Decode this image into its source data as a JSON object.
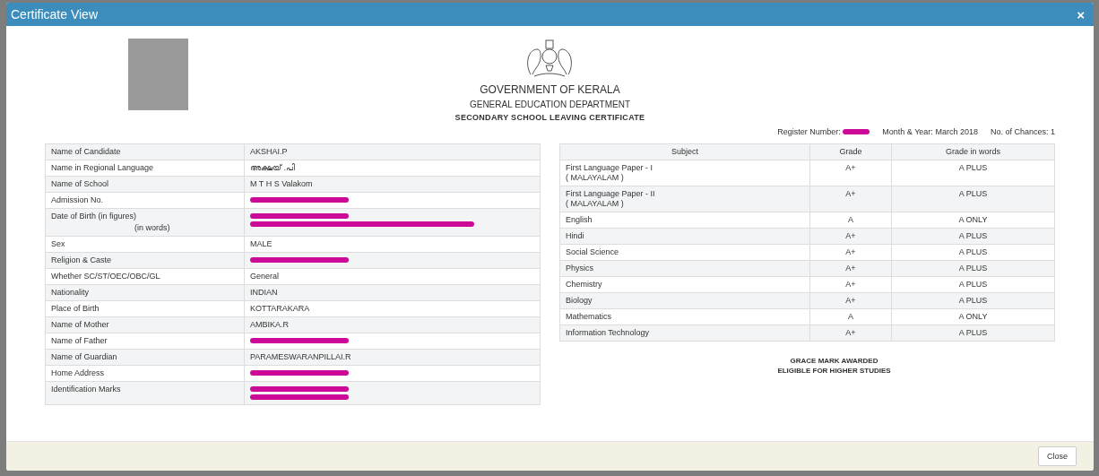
{
  "window": {
    "title": "Certificate View",
    "close_glyph": "×"
  },
  "header": {
    "lines": [
      {
        "kind": "title",
        "text": "GOVERNMENT OF KERALA"
      },
      {
        "kind": "subtitle",
        "text": "GENERAL EDUCATION DEPARTMENT"
      },
      {
        "kind": "heading",
        "text": "SECONDARY SCHOOL LEAVING CERTIFICATE"
      }
    ]
  },
  "meta": [
    {
      "label": "Register Number:",
      "redacted": true
    },
    {
      "label": "Month & Year:",
      "value": "March 2018",
      "redacted": false
    },
    {
      "label": "No. of Chances:",
      "value": "1",
      "redacted": false
    }
  ],
  "candidate_details": [
    {
      "labels": [
        "Name of Candidate"
      ],
      "values": [
        {
          "text": "AKSHAI.P",
          "redacted": false
        }
      ]
    },
    {
      "labels": [
        "Name in Regional Language"
      ],
      "values": [
        {
          "text": "അക്ഷയ് .പി",
          "redacted": false
        }
      ]
    },
    {
      "labels": [
        "Name of School"
      ],
      "values": [
        {
          "text": "M T H S Valakom",
          "redacted": false
        }
      ]
    },
    {
      "labels": [
        "Admission No."
      ],
      "values": [
        {
          "redacted": true
        }
      ]
    },
    {
      "labels": [
        "Date of Birth (in figures)",
        "(in words)"
      ],
      "values": [
        {
          "redacted": true
        },
        {
          "redacted": true
        }
      ]
    },
    {
      "labels": [
        "Sex"
      ],
      "values": [
        {
          "text": "MALE",
          "redacted": false
        }
      ]
    },
    {
      "labels": [
        "Religion & Caste"
      ],
      "values": [
        {
          "redacted": true
        }
      ]
    },
    {
      "labels": [
        "Whether SC/ST/OEC/OBC/GL"
      ],
      "values": [
        {
          "text": "General",
          "redacted": false
        }
      ]
    },
    {
      "labels": [
        "Nationality"
      ],
      "values": [
        {
          "text": "INDIAN",
          "redacted": false
        }
      ]
    },
    {
      "labels": [
        "Place of Birth"
      ],
      "values": [
        {
          "text": "KOTTARAKARA",
          "redacted": false
        }
      ]
    },
    {
      "labels": [
        "Name of Mother"
      ],
      "values": [
        {
          "text": "AMBIKA.R",
          "redacted": false
        }
      ]
    },
    {
      "labels": [
        "Name of Father"
      ],
      "values": [
        {
          "redacted": true
        }
      ]
    },
    {
      "labels": [
        "Name of Guardian"
      ],
      "values": [
        {
          "text": "PARAMESWARANPILLAI.R",
          "redacted": false
        }
      ]
    },
    {
      "labels": [
        "Home Address"
      ],
      "values": [
        {
          "redacted": true
        }
      ]
    },
    {
      "labels": [
        "Identification Marks"
      ],
      "values": [
        {
          "redacted": true
        },
        {
          "redacted": true
        }
      ]
    }
  ],
  "grades": {
    "columns": [
      "Subject",
      "Grade",
      "Grade in words"
    ],
    "rows": [
      {
        "subject": [
          "First Language Paper - I",
          "( MALAYALAM )"
        ],
        "grade": "A+",
        "grade_words": "A PLUS"
      },
      {
        "subject": [
          "First Language Paper - II",
          "( MALAYALAM )"
        ],
        "grade": "A+",
        "grade_words": "A PLUS"
      },
      {
        "subject": [
          "English"
        ],
        "grade": "A",
        "grade_words": "A ONLY"
      },
      {
        "subject": [
          "Hindi"
        ],
        "grade": "A+",
        "grade_words": "A PLUS"
      },
      {
        "subject": [
          "Social Science"
        ],
        "grade": "A+",
        "grade_words": "A PLUS"
      },
      {
        "subject": [
          "Physics"
        ],
        "grade": "A+",
        "grade_words": "A PLUS"
      },
      {
        "subject": [
          "Chemistry"
        ],
        "grade": "A+",
        "grade_words": "A PLUS"
      },
      {
        "subject": [
          "Biology"
        ],
        "grade": "A+",
        "grade_words": "A PLUS"
      },
      {
        "subject": [
          "Mathematics"
        ],
        "grade": "A",
        "grade_words": "A ONLY"
      },
      {
        "subject": [
          "Information Technology"
        ],
        "grade": "A+",
        "grade_words": "A PLUS"
      }
    ]
  },
  "remarks": [
    "GRACE MARK AWARDED",
    "ELIGIBLE FOR HIGHER STUDIES"
  ],
  "footer": {
    "buttons": [
      "Close"
    ]
  }
}
